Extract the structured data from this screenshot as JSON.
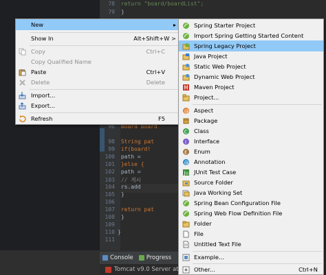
{
  "code": [
    {
      "ln": "78",
      "text": "        return \"board/boardList\";"
    },
    {
      "ln": "79",
      "text": "    }"
    },
    {
      "ln": "96",
      "text": "        Board board"
    },
    {
      "ln": "98",
      "text": "        String pat"
    },
    {
      "ln": "99",
      "text": "        if(board!"
    },
    {
      "ln": "100",
      "text": "            path ="
    },
    {
      "ln": "101",
      "text": "        }else {"
    },
    {
      "ln": "102",
      "text": "            path ="
    },
    {
      "ln": "103",
      "text": "            // 게시"
    },
    {
      "ln": "104",
      "text": "            rs.add"
    },
    {
      "ln": "105",
      "text": "        }"
    },
    {
      "ln": "106",
      "text": ""
    },
    {
      "ln": "107",
      "text": "        return pat"
    },
    {
      "ln": "108",
      "text": "    }"
    },
    {
      "ln": "109",
      "text": ""
    },
    {
      "ln": "110",
      "text": "}"
    },
    {
      "ln": "111",
      "text": ""
    }
  ],
  "context_menu": {
    "items": [
      {
        "label": "New",
        "shortcut": "",
        "submenu": true,
        "selected": true
      },
      {
        "label": "Show In",
        "shortcut": "Alt+Shift+W >",
        "icon": ""
      },
      {
        "label": "Copy",
        "shortcut": "Ctrl+C",
        "disabled": true,
        "icon": "copy-icon"
      },
      {
        "label": "Copy Qualified Name",
        "shortcut": "",
        "disabled": true,
        "icon": ""
      },
      {
        "label": "Paste",
        "shortcut": "Ctrl+V",
        "icon": "paste-icon"
      },
      {
        "label": "Delete",
        "shortcut": "Delete",
        "disabled": true,
        "icon": "delete-icon"
      },
      {
        "label": "Import...",
        "shortcut": "",
        "icon": "import-icon"
      },
      {
        "label": "Export...",
        "shortcut": "",
        "icon": "export-icon"
      },
      {
        "label": "Refresh",
        "shortcut": "F5",
        "icon": "refresh-icon"
      }
    ]
  },
  "new_submenu": {
    "items": [
      {
        "label": "Spring Starter Project",
        "icon": "spring-icon"
      },
      {
        "label": "Import Spring Getting Started Content",
        "icon": "spring-icon"
      },
      {
        "label": "Spring Legacy Project",
        "icon": "spring-legacy-icon",
        "selected": true
      },
      {
        "label": "Java Project",
        "icon": "java-project-icon"
      },
      {
        "label": "Static Web Project",
        "icon": "web-project-icon"
      },
      {
        "label": "Dynamic Web Project",
        "icon": "web-project-icon"
      },
      {
        "label": "Maven Project",
        "icon": "maven-icon"
      },
      {
        "label": "Project...",
        "icon": "project-icon"
      },
      {
        "label": "Aspect",
        "icon": "aspect-icon"
      },
      {
        "label": "Package",
        "icon": "package-icon"
      },
      {
        "label": "Class",
        "icon": "class-icon"
      },
      {
        "label": "Interface",
        "icon": "interface-icon"
      },
      {
        "label": "Enum",
        "icon": "enum-icon"
      },
      {
        "label": "Annotation",
        "icon": "annotation-icon"
      },
      {
        "label": "JUnit Test Case",
        "icon": "junit-icon"
      },
      {
        "label": "Source Folder",
        "icon": "source-folder-icon"
      },
      {
        "label": "Java Working Set",
        "icon": "working-set-icon"
      },
      {
        "label": "Spring Bean Configuration File",
        "icon": "spring-icon"
      },
      {
        "label": "Spring Web Flow Definition File",
        "icon": "spring-icon"
      },
      {
        "label": "Folder",
        "icon": "folder-icon"
      },
      {
        "label": "File",
        "icon": "file-icon"
      },
      {
        "label": "Untitled Text File",
        "icon": "text-file-icon"
      },
      {
        "label": "Example...",
        "icon": "example-icon"
      },
      {
        "label": "Other...",
        "shortcut": "Ctrl+N",
        "icon": "other-icon"
      }
    ]
  },
  "bottom_panel": {
    "tabs": [
      {
        "label": "Console"
      },
      {
        "label": "Progress"
      }
    ],
    "status": "Tomcat v9.0 Server at l"
  },
  "colors": {
    "selection": "#91c9f7",
    "menu_bg": "#f0f0f0",
    "editor_bg": "#2b2b2b"
  }
}
